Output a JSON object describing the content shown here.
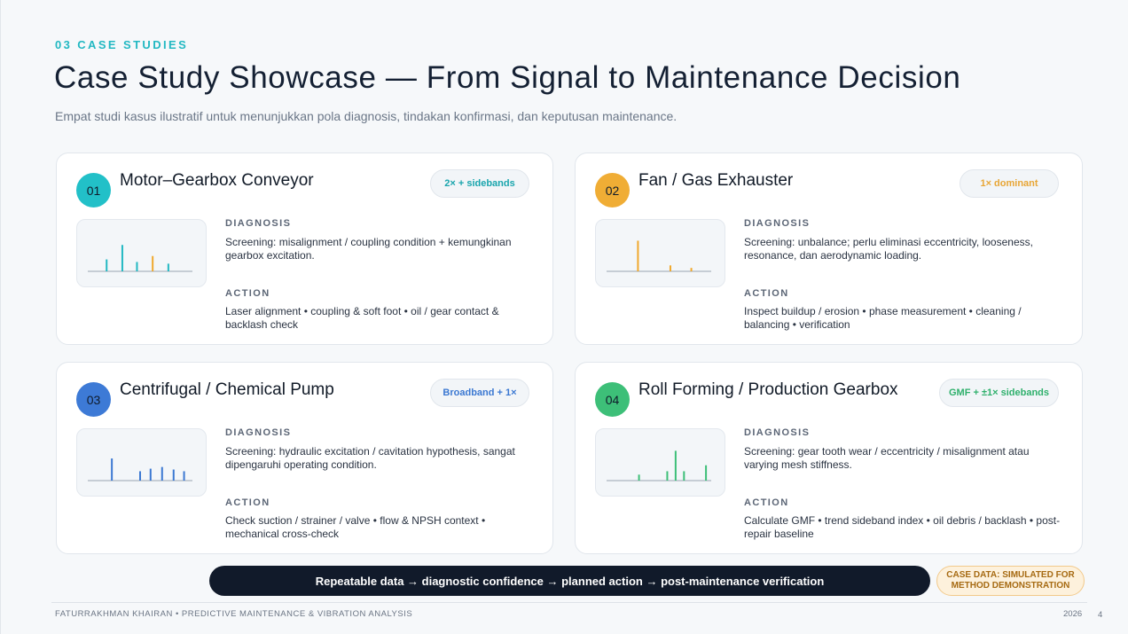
{
  "header": {
    "section_label": "03  CASE STUDIES",
    "title": "Case Study Showcase — From Signal to Maintenance Decision",
    "subtitle": "Empat studi kasus ilustratif untuk menunjukkan pola diagnosis, tindakan konfirmasi, dan keputusan maintenance."
  },
  "cards": [
    {
      "number": "01",
      "title": "Motor–Gearbox Conveyor",
      "tag": "2× + sidebands",
      "badge_color": "#22c0c8",
      "tag_color": "#1aa5ad",
      "diagnosis_label": "DIAGNOSIS",
      "diagnosis": "Screening: misalignment / coupling condition + kemungkinan gearbox excitation.",
      "action_label": "ACTION",
      "action": "Laser alignment • coupling & soft foot • oil / gear contact & backlash check",
      "spectrum": [
        {
          "f": 0.18,
          "a": 0.28,
          "color": "#22b8c2"
        },
        {
          "f": 0.33,
          "a": 0.62,
          "color": "#22b8c2"
        },
        {
          "f": 0.47,
          "a": 0.22,
          "color": "#22b8c2"
        },
        {
          "f": 0.62,
          "a": 0.36,
          "color": "#f0a92e"
        },
        {
          "f": 0.77,
          "a": 0.18,
          "color": "#22b8c2"
        }
      ]
    },
    {
      "number": "02",
      "title": "Fan / Gas Exhauster",
      "tag": "1× dominant",
      "badge_color": "#f0ad35",
      "tag_color": "#e8a636",
      "diagnosis_label": "DIAGNOSIS",
      "diagnosis": "Screening: unbalance; perlu eliminasi eccentricity, looseness, resonance, dan aerodynamic loading.",
      "action_label": "ACTION",
      "action": "Inspect buildup / erosion • phase measurement • cleaning / balancing • verification",
      "spectrum": [
        {
          "f": 0.3,
          "a": 0.72,
          "color": "#f0a92e"
        },
        {
          "f": 0.61,
          "a": 0.14,
          "color": "#f0a92e"
        },
        {
          "f": 0.81,
          "a": 0.08,
          "color": "#f0a92e"
        }
      ]
    },
    {
      "number": "03",
      "title": "Centrifugal / Chemical Pump",
      "tag": "Broadband + 1×",
      "badge_color": "#3d7ad6",
      "tag_color": "#3b78d2",
      "diagnosis_label": "DIAGNOSIS",
      "diagnosis": "Screening: hydraulic excitation / cavitation hypothesis, sangat dipengaruhi operating condition.",
      "action_label": "ACTION",
      "action": "Check suction / strainer / valve • flow & NPSH context • mechanical cross-check",
      "spectrum": [
        {
          "f": 0.23,
          "a": 0.52,
          "color": "#3b78d2"
        },
        {
          "f": 0.5,
          "a": 0.22,
          "color": "#3b78d2"
        },
        {
          "f": 0.6,
          "a": 0.28,
          "color": "#3b78d2"
        },
        {
          "f": 0.71,
          "a": 0.32,
          "color": "#3b78d2"
        },
        {
          "f": 0.82,
          "a": 0.26,
          "color": "#3b78d2"
        },
        {
          "f": 0.92,
          "a": 0.22,
          "color": "#3b78d2"
        }
      ]
    },
    {
      "number": "04",
      "title": "Roll Forming / Production Gearbox",
      "tag": "GMF + ±1× sidebands",
      "badge_color": "#3dbf78",
      "tag_color": "#2fb06c",
      "diagnosis_label": "DIAGNOSIS",
      "diagnosis": "Screening: gear tooth wear / eccentricity / misalignment atau varying mesh stiffness.",
      "action_label": "ACTION",
      "action": "Calculate GMF • trend sideband index • oil debris / backlash • post-repair baseline",
      "spectrum": [
        {
          "f": 0.31,
          "a": 0.14,
          "color": "#3dbf78"
        },
        {
          "f": 0.58,
          "a": 0.22,
          "color": "#3dbf78"
        },
        {
          "f": 0.66,
          "a": 0.7,
          "color": "#3dbf78"
        },
        {
          "f": 0.74,
          "a": 0.22,
          "color": "#3dbf78"
        },
        {
          "f": 0.95,
          "a": 0.36,
          "color": "#3dbf78"
        }
      ]
    }
  ],
  "flow_banner": "Repeatable data → diagnostic confidence → planned action → post-maintenance verification",
  "note_badge": "CASE DATA: SIMULATED FOR METHOD DEMONSTRATION",
  "footer": {
    "author": "FATURRAKHMAN KHAIRAN  •  PREDICTIVE MAINTENANCE & VIBRATION ANALYSIS",
    "year": "2026",
    "page": "4"
  }
}
